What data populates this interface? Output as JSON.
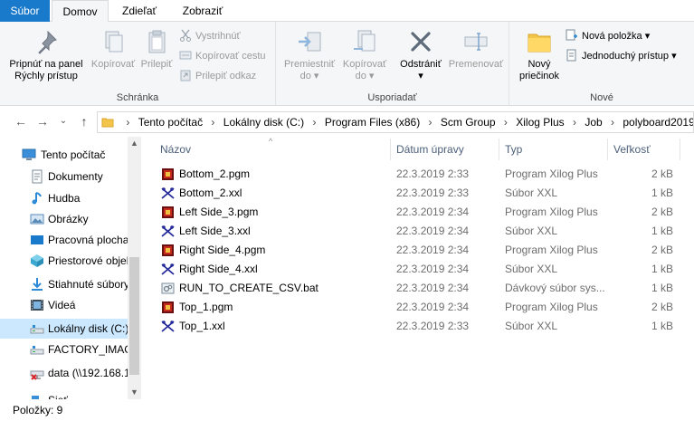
{
  "ribbon_tabs": {
    "file": "Súbor",
    "home": "Domov",
    "share": "Zdieľať",
    "view": "Zobraziť"
  },
  "clipboard": {
    "pin_line1": "Pripnúť na panel",
    "pin_line2": "Rýchly prístup",
    "copy": "Kopírovať",
    "paste": "Prilepiť",
    "cut": "Vystrihnúť",
    "copy_path": "Kopírovať cestu",
    "paste_shortcut": "Prilepiť odkaz",
    "group_label": "Schránka"
  },
  "organize": {
    "move_line1": "Premiestniť",
    "move_line2": "do",
    "copy_line1": "Kopírovať",
    "copy_line2": "do",
    "delete_line1": "Odstrániť",
    "rename": "Premenovať",
    "group_label": "Usporiadať"
  },
  "new_group": {
    "new_folder_line1": "Nový",
    "new_folder_line2": "priečinok",
    "new_item": "Nová položka",
    "easy_access": "Jednoduchý prístup",
    "group_label": "Nové"
  },
  "navigation": {
    "back": "←",
    "forward": "→",
    "recent": "⌄",
    "up": "↑"
  },
  "breadcrumbs": [
    "Tento počítač",
    "Lokálny disk (C:)",
    "Program Files (x86)",
    "Scm Group",
    "Xilog Plus",
    "Job",
    "polyboard2019"
  ],
  "nav_pane": {
    "items": [
      {
        "label": "Tento počítač",
        "icon": "computer-icon"
      },
      {
        "label": "Dokumenty",
        "icon": "documents-icon"
      },
      {
        "label": "Hudba",
        "icon": "music-icon"
      },
      {
        "label": "Obrázky",
        "icon": "pictures-icon"
      },
      {
        "label": "Pracovná plocha",
        "icon": "desktop-icon"
      },
      {
        "label": "Priestorové objekty",
        "icon": "3d-objects-icon"
      },
      {
        "label": "Stiahnuté súbory",
        "icon": "downloads-icon"
      },
      {
        "label": "Videá",
        "icon": "videos-icon"
      },
      {
        "label": "Lokálny disk (C:)",
        "icon": "drive-icon"
      },
      {
        "label": "FACTORY_IMAGE",
        "icon": "drive-icon"
      },
      {
        "label": "data (\\\\192.168.1",
        "icon": "network-drive-icon"
      },
      {
        "label": "Sieť",
        "icon": "network-icon"
      }
    ],
    "selected_index": 8
  },
  "columns": {
    "name": "Názov",
    "date": "Dátum úpravy",
    "type": "Typ",
    "size": "Veľkosť"
  },
  "files": [
    {
      "name": "Bottom_2.pgm",
      "date": "22.3.2019 2:33",
      "type": "Program Xilog Plus",
      "size": "2 kB",
      "icon": "xilog-program-icon"
    },
    {
      "name": "Bottom_2.xxl",
      "date": "22.3.2019 2:33",
      "type": "Súbor XXL",
      "size": "1 kB",
      "icon": "xxl-file-icon"
    },
    {
      "name": "Left Side_3.pgm",
      "date": "22.3.2019 2:34",
      "type": "Program Xilog Plus",
      "size": "2 kB",
      "icon": "xilog-program-icon"
    },
    {
      "name": "Left Side_3.xxl",
      "date": "22.3.2019 2:34",
      "type": "Súbor XXL",
      "size": "1 kB",
      "icon": "xxl-file-icon"
    },
    {
      "name": "Right Side_4.pgm",
      "date": "22.3.2019 2:34",
      "type": "Program Xilog Plus",
      "size": "2 kB",
      "icon": "xilog-program-icon"
    },
    {
      "name": "Right Side_4.xxl",
      "date": "22.3.2019 2:34",
      "type": "Súbor XXL",
      "size": "1 kB",
      "icon": "xxl-file-icon"
    },
    {
      "name": "RUN_TO_CREATE_CSV.bat",
      "date": "22.3.2019 2:34",
      "type": "Dávkový súbor sys...",
      "size": "1 kB",
      "icon": "batch-file-icon"
    },
    {
      "name": "Top_1.pgm",
      "date": "22.3.2019 2:34",
      "type": "Program Xilog Plus",
      "size": "2 kB",
      "icon": "xilog-program-icon"
    },
    {
      "name": "Top_1.xxl",
      "date": "22.3.2019 2:33",
      "type": "Súbor XXL",
      "size": "1 kB",
      "icon": "xxl-file-icon"
    }
  ],
  "status": {
    "count": "Položky: 9"
  },
  "colors": {
    "accent": "#1979ca",
    "selection": "#cce8ff",
    "ribbon_bg": "#f5f6f7",
    "header_text": "#4c607a"
  }
}
